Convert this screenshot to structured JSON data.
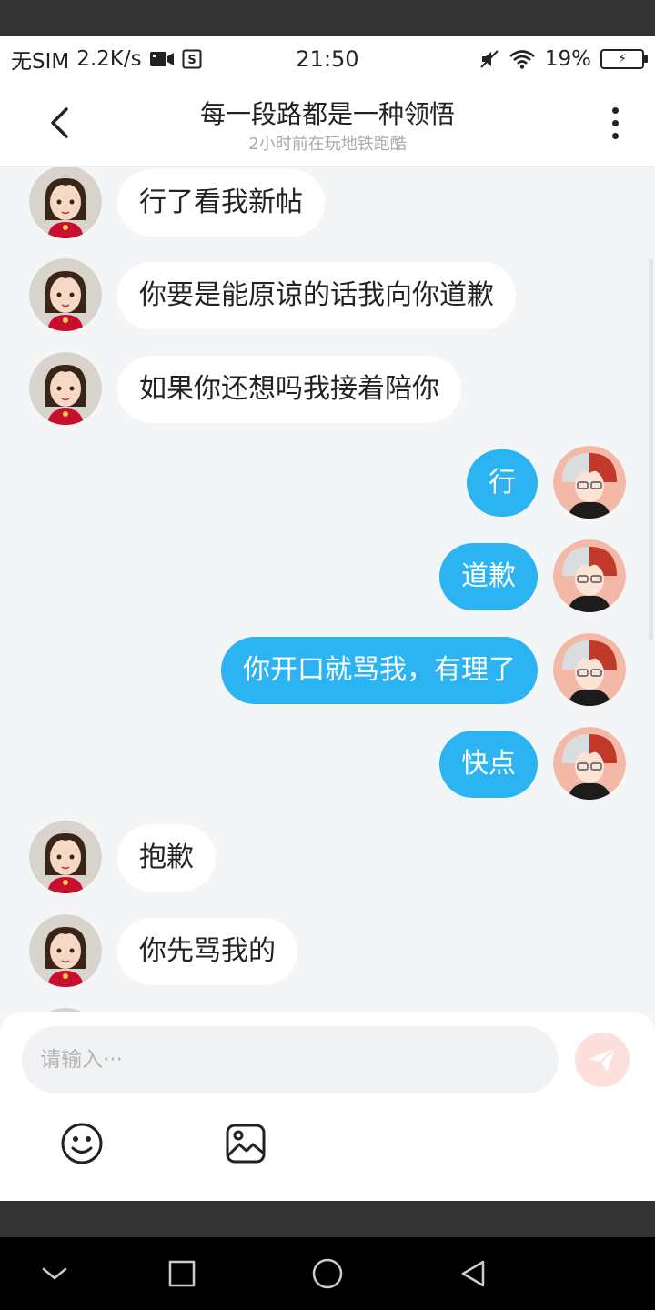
{
  "status_bar": {
    "carrier": "无SIM",
    "speed": "2.2K/s",
    "time": "21:50",
    "battery": "19%"
  },
  "header": {
    "title": "每一段路都是一种领悟",
    "subtitle": "2小时前在玩地铁跑酷"
  },
  "messages": [
    {
      "side": "left",
      "text": "行了看我新帖"
    },
    {
      "side": "left",
      "text": "你要是能原谅的话我向你道歉"
    },
    {
      "side": "left",
      "text": "如果你还想吗我接着陪你"
    },
    {
      "side": "right",
      "text": "行"
    },
    {
      "side": "right",
      "text": "道歉"
    },
    {
      "side": "right",
      "text": "你开口就骂我，有理了"
    },
    {
      "side": "right",
      "text": "快点"
    },
    {
      "side": "left",
      "text": "抱歉"
    },
    {
      "side": "left",
      "text": "你先骂我的"
    }
  ],
  "input": {
    "placeholder": "请输入···"
  },
  "colors": {
    "accent": "#2cb4f2",
    "send_button": "#fde0dc",
    "background": "#f3f5f7"
  },
  "icons": {
    "back": "chevron-left-icon",
    "more": "more-vertical-icon",
    "send": "send-icon",
    "emoji": "emoji-icon",
    "image": "image-icon"
  }
}
